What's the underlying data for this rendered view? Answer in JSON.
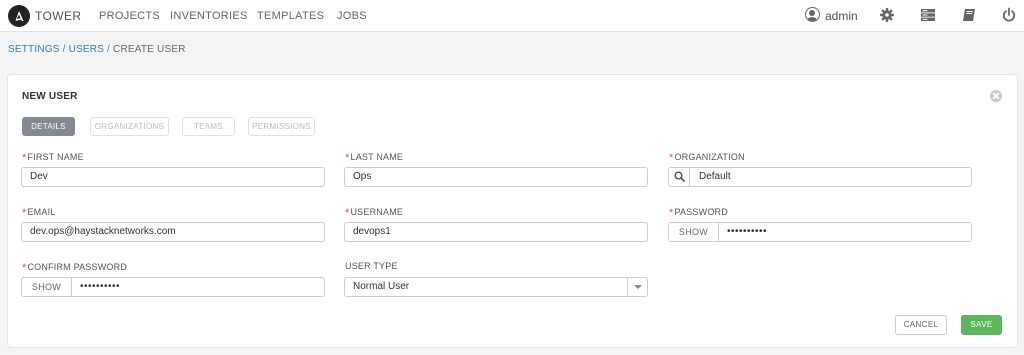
{
  "header": {
    "brand": "TOWER",
    "nav": [
      {
        "label": "PROJECTS"
      },
      {
        "label": "INVENTORIES"
      },
      {
        "label": "TEMPLATES"
      },
      {
        "label": "JOBS"
      }
    ],
    "user": "admin",
    "icons": [
      "user-icon",
      "settings-gear-icon",
      "server-icon",
      "book-icon",
      "power-icon"
    ]
  },
  "breadcrumb": {
    "settings": "SETTINGS",
    "users": "USERS",
    "current": "CREATE USER",
    "separator": "/"
  },
  "form": {
    "title": "NEW USER",
    "tabs": [
      {
        "label": "DETAILS",
        "active": true
      },
      {
        "label": "ORGANIZATIONS",
        "active": false
      },
      {
        "label": "TEAMS",
        "active": false
      },
      {
        "label": "PERMISSIONS",
        "active": false
      }
    ],
    "required_mark": "*",
    "first_name": {
      "label": "FIRST NAME",
      "value": "Dev"
    },
    "last_name": {
      "label": "LAST NAME",
      "value": "Ops"
    },
    "organization": {
      "label": "ORGANIZATION",
      "value": "Default"
    },
    "email": {
      "label": "EMAIL",
      "value": "dev.ops@haystacknetworks.com"
    },
    "username": {
      "label": "USERNAME",
      "value": "devops1"
    },
    "password": {
      "label": "PASSWORD",
      "show_label": "SHOW",
      "value": "••••••••••"
    },
    "confirm_password": {
      "label": "CONFIRM PASSWORD",
      "show_label": "SHOW",
      "value": "••••••••••"
    },
    "user_type": {
      "label": "USER TYPE",
      "value": "Normal User"
    },
    "cancel_label": "CANCEL",
    "save_label": "SAVE"
  },
  "colors": {
    "save": "#5cb85c",
    "active_tab": "#848992",
    "required": "#d9534f",
    "link": "#337ab7"
  }
}
